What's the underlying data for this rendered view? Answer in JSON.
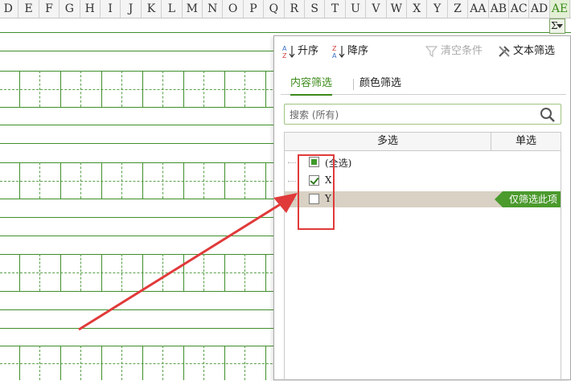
{
  "spreadsheet": {
    "columns": [
      "D",
      "E",
      "F",
      "G",
      "H",
      "I",
      "J",
      "K",
      "L",
      "M",
      "N",
      "O",
      "P",
      "Q",
      "R",
      "S",
      "T",
      "U",
      "V",
      "W",
      "X",
      "Y",
      "Z",
      "AA",
      "AB",
      "AC",
      "AD",
      "AE"
    ],
    "selected_column": "AE",
    "filter_button_glyph": "Σ"
  },
  "filter_panel": {
    "toolbar": {
      "sort_asc": "升序",
      "sort_desc": "降序",
      "clear": "清空条件",
      "text_filter": "文本筛选"
    },
    "tabs": {
      "content": "内容筛选",
      "color": "颜色筛选",
      "active": "content"
    },
    "search": {
      "placeholder": "搜索 (所有)"
    },
    "list_header": {
      "multi": "多选",
      "single": "单选"
    },
    "items": [
      {
        "label": "(全选)",
        "state": "partial"
      },
      {
        "label": "X",
        "state": "checked"
      },
      {
        "label": "Y",
        "state": "unchecked",
        "highlighted": true
      }
    ],
    "only_filter_label": "仅筛选此项"
  },
  "colors": {
    "accent": "#3b8a1a",
    "annotation": "#e03a3a"
  }
}
